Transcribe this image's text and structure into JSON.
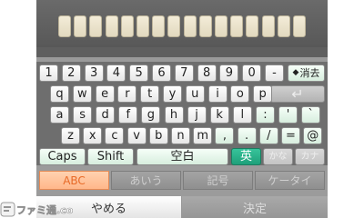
{
  "input_slots": 16,
  "keyboard": {
    "row1": [
      "1",
      "2",
      "3",
      "4",
      "5",
      "6",
      "7",
      "8",
      "9",
      "0",
      "-"
    ],
    "delete_label": "消去",
    "row2": [
      "q",
      "w",
      "e",
      "r",
      "t",
      "y",
      "u",
      "i",
      "o",
      "p"
    ],
    "enter_icon": "return-arrow-icon",
    "row3": [
      "a",
      "s",
      "d",
      "f",
      "g",
      "h",
      "j",
      "k",
      "l",
      ":",
      "'",
      "`"
    ],
    "row4": [
      "z",
      "x",
      "c",
      "v",
      "b",
      "n",
      "m",
      ",",
      ".",
      "/",
      "=",
      "@"
    ],
    "caps_label": "Caps",
    "shift_label": "Shift",
    "space_label": "空白",
    "eng_label": "英",
    "kana_label": "かな",
    "katakana_label": "カナ"
  },
  "modes": {
    "abc": "ABC",
    "hiragana": "あいう",
    "symbols": "記号",
    "keitai": "ケータイ",
    "active": "ABC"
  },
  "bottom": {
    "cancel_label": "やめる",
    "ok_label": "決定"
  },
  "watermark": {
    "text": "ファミ通.com"
  },
  "colors": {
    "accent_green": "#1ea07a",
    "active_tab": "#ffb78a",
    "active_tab_text": "#e86a28"
  }
}
